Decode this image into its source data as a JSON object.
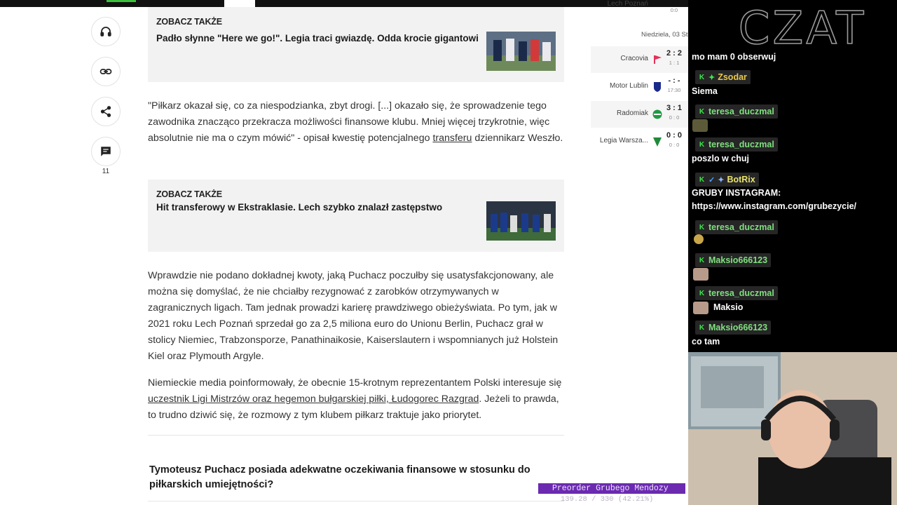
{
  "icons": {
    "listen": "headphones-icon",
    "copy_link": "link-icon",
    "share": "share-icon",
    "comments": "comment-icon"
  },
  "rail": {
    "comment_count": "11"
  },
  "see_also": [
    {
      "heading": "ZOBACZ TAKŻE",
      "title": "Padło słynne \"Here we go!\". Legia traci gwiazdę. Odda krocie gigantowi"
    },
    {
      "heading": "ZOBACZ TAKŻE",
      "title": "Hit transferowy w Ekstraklasie. Lech szybko znalazł zastępstwo"
    }
  ],
  "paragraphs": {
    "p1_pre": "\"Piłkarz okazał się, co za niespodzianka, zbyt drogi. [...] okazało się, że sprowadzenie tego zawodnika znacząco przekracza możliwości finansowe klubu. Mniej więcej trzykrotnie, więc absolutnie nie ma o czym mówić\" - opisał kwestię potencjalnego ",
    "p1_link": "transferu",
    "p1_post": " dziennikarz Weszło.",
    "p2": "Wprawdzie nie podano dokładnej kwoty, jaką Puchacz poczułby się usatysfakcjonowany, ale można się domyślać, że nie chciałby rezygnować z zarobków otrzymywanych w zagranicznych ligach. Tam jednak prowadzi karierę prawdziwego obieżyświata. Po tym, jak w 2021 roku Lech Poznań sprzedał go za 2,5 miliona euro do Unionu Berlin, Puchacz grał w stolicy Niemiec, Trabzonsporze, Panathinaikosie, Kaiserslautern i wspomnianych już Holstein Kiel oraz Plymouth Argyle.",
    "p3_pre": "Niemieckie media poinformowały, że obecnie 15-krotnym reprezentantem Polski interesuje się ",
    "p3_link": "uczestnik Ligi Mistrzów oraz hegemon bułgarskiej piłki, Łudogorec Razgrad",
    "p3_post": ". Jeżeli to prawda, to trudno dziwić się, że rozmowy z tym klubem piłkarz traktuje jako priorytet."
  },
  "faq_question": "Tymoteusz Puchacz posiada adekwatne oczekiwania finansowe w stosunku do piłkarskich umiejętności?",
  "scores": {
    "top_row": {
      "team": "Lech Poznań",
      "sub": "0:0"
    },
    "date": "Niedziela, 03 St",
    "matches": [
      {
        "team": "Cracovia",
        "score": "2 : 2",
        "sub": "1 : 1",
        "crest_color": "#e2325a"
      },
      {
        "team": "Motor Lublin",
        "score": "- : -",
        "sub": "17:30",
        "crest_color": "#1a2a8a"
      },
      {
        "team": "Radomiak",
        "score": "3 : 1",
        "sub": "0 : 0",
        "crest_color": "#1f9a44"
      },
      {
        "team": "Legia Warsza...",
        "score": "0 : 0",
        "sub": "0 : 0",
        "crest_color": "#1f8a3a"
      }
    ]
  },
  "chat": {
    "title": "CZAT",
    "messages": [
      {
        "text": "mo mam 0 obserwuj"
      },
      {
        "user": "Zsodar",
        "user_color": "#e8c94a",
        "text": "Siema"
      },
      {
        "user": "teresa_duczmal",
        "user_color": "#7fe07f",
        "emote": "rock-emote"
      },
      {
        "user": "teresa_duczmal",
        "user_color": "#7fe07f",
        "text": "poszlo w chuj"
      },
      {
        "user": "BotRix",
        "user_color": "#e8e26a",
        "text": "GRUBY INSTAGRAM:",
        "text2": "https://www.instagram.com/grubezycie/"
      },
      {
        "user": "teresa_duczmal",
        "user_color": "#7fe07f",
        "emote": "coin-emote"
      },
      {
        "user": "Maksio666123",
        "user_color": "#7fe07f",
        "emote": "face-emote"
      },
      {
        "user": "teresa_duczmal",
        "user_color": "#7fe07f",
        "emote": "face-emote",
        "text": "Maksio"
      },
      {
        "user": "Maksio666123",
        "user_color": "#7fe07f",
        "text": "co tam"
      }
    ]
  },
  "ticker": {
    "preorder": "Preorder Grubego Mendozy",
    "progress": "139.28 / 330 (42.21%)",
    "progress_fraction": 0.4221
  }
}
